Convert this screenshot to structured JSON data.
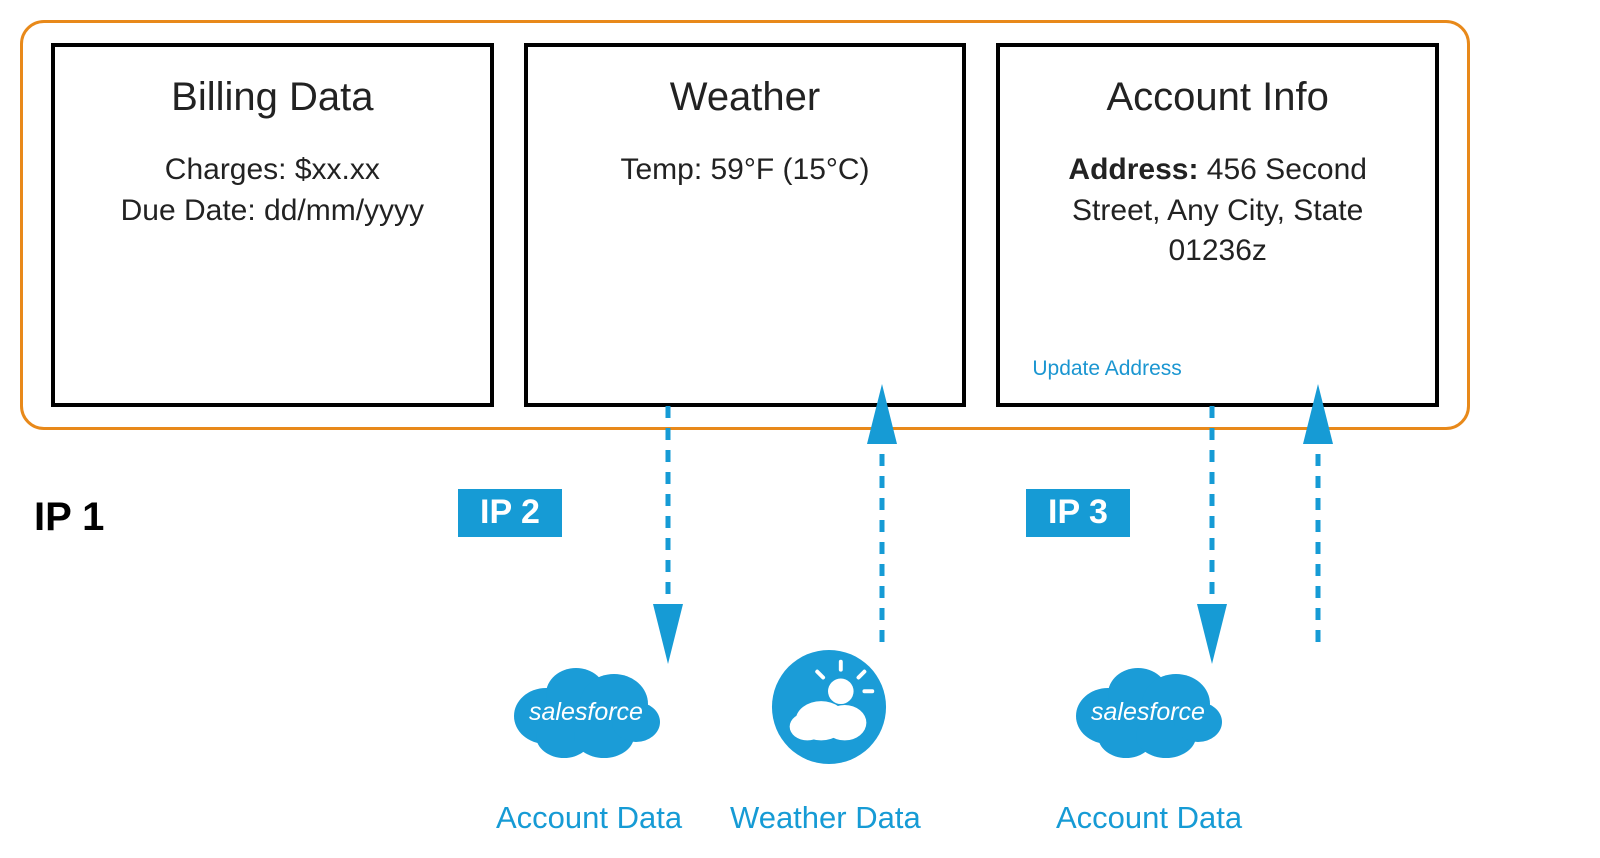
{
  "outer_group_label": "IP 1",
  "cards": {
    "billing": {
      "title": "Billing Data",
      "charges_label": "Charges:",
      "charges_value": "$xx.xx",
      "due_label": "Due Date:",
      "due_value": "dd/mm/yyyy"
    },
    "weather": {
      "title": "Weather",
      "temp_label": "Temp:",
      "temp_value": "59°F (15°C)"
    },
    "account": {
      "title": "Account Info",
      "address_label": "Address:",
      "address_value": "456 Second Street, Any City, State 01236z",
      "update_link": "Update Address"
    }
  },
  "ip_badges": {
    "ip2": "IP 2",
    "ip3": "IP 3"
  },
  "sources": {
    "salesforce_label": "salesforce",
    "account_data": "Account Data",
    "weather_data": "Weather Data"
  },
  "colors": {
    "brand_blue": "#169bd5",
    "orange": "#e8891a"
  }
}
